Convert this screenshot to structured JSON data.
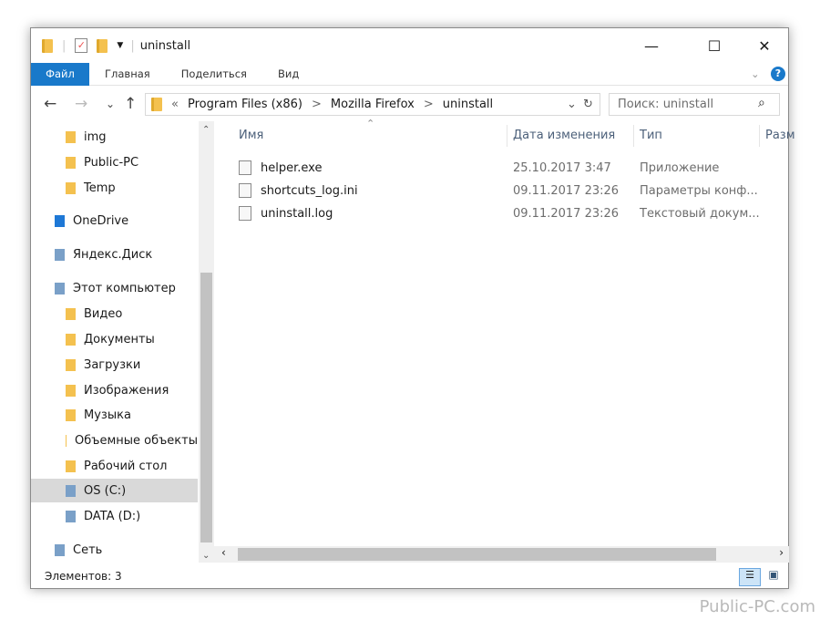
{
  "window": {
    "title": "uninstall",
    "minimize": "—",
    "maximize": "☐",
    "close": "✕"
  },
  "ribbon": {
    "tabs": [
      "Файл",
      "Главная",
      "Поделиться",
      "Вид"
    ],
    "help": "?"
  },
  "address": {
    "prefix": "«",
    "crumbs": [
      "Program Files (x86)",
      "Mozilla Firefox",
      "uninstall"
    ],
    "sep": ">",
    "search_placeholder": "Поиск: uninstall"
  },
  "sidebar": {
    "items": [
      {
        "label": "img",
        "icon": "folder-icon"
      },
      {
        "label": "Public-PC",
        "icon": "folder-icon"
      },
      {
        "label": "Temp",
        "icon": "folder-icon"
      },
      {
        "label": "OneDrive",
        "icon": "cloud-icon"
      },
      {
        "label": "Яндекс.Диск",
        "icon": "yandex-disk-icon"
      },
      {
        "label": "Этот компьютер",
        "icon": "computer-icon"
      },
      {
        "label": "Видео",
        "icon": "video-folder-icon"
      },
      {
        "label": "Документы",
        "icon": "documents-folder-icon"
      },
      {
        "label": "Загрузки",
        "icon": "downloads-folder-icon"
      },
      {
        "label": "Изображения",
        "icon": "pictures-folder-icon"
      },
      {
        "label": "Музыка",
        "icon": "music-folder-icon"
      },
      {
        "label": "Объемные объекты",
        "icon": "3d-objects-folder-icon"
      },
      {
        "label": "Рабочий стол",
        "icon": "desktop-folder-icon"
      },
      {
        "label": "OS (C:)",
        "icon": "drive-icon"
      },
      {
        "label": "DATA (D:)",
        "icon": "drive-icon"
      },
      {
        "label": "Сеть",
        "icon": "network-icon"
      }
    ]
  },
  "columns": [
    "Имя",
    "Дата изменения",
    "Тип",
    "Разм"
  ],
  "files": [
    {
      "name": "helper.exe",
      "date": "25.10.2017 3:47",
      "type": "Приложение"
    },
    {
      "name": "shortcuts_log.ini",
      "date": "09.11.2017 23:26",
      "type": "Параметры конф..."
    },
    {
      "name": "uninstall.log",
      "date": "09.11.2017 23:26",
      "type": "Текстовый докум..."
    }
  ],
  "status": "Элементов: 3",
  "watermark": "Public-PC.com",
  "colors": {
    "accent": "#1979ca"
  }
}
